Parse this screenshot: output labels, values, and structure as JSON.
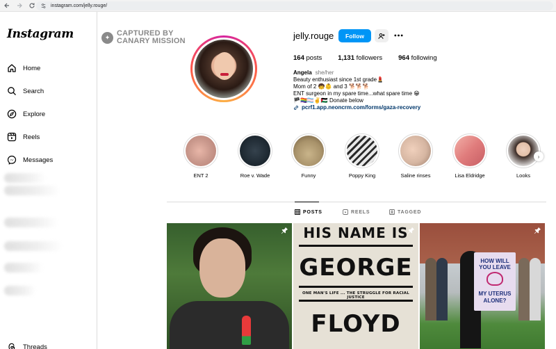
{
  "browser": {
    "url": "instagram.com/jelly.rouge/"
  },
  "sidebar": {
    "logo": "Instagram",
    "items": [
      {
        "label": "Home",
        "icon": "home-icon"
      },
      {
        "label": "Search",
        "icon": "search-icon"
      },
      {
        "label": "Explore",
        "icon": "compass-icon"
      },
      {
        "label": "Reels",
        "icon": "reels-icon"
      },
      {
        "label": "Messages",
        "icon": "messenger-icon"
      }
    ],
    "bottom_item": {
      "label": "Threads",
      "icon": "threads-icon"
    }
  },
  "watermark": {
    "line1": "CAPTURED BY",
    "line2": "CANARY MISSION"
  },
  "profile": {
    "username": "jelly.rouge",
    "follow_label": "Follow",
    "stats": {
      "posts_count": "164",
      "posts_label": "posts",
      "followers_count": "1,131",
      "followers_label": "followers",
      "following_count": "964",
      "following_label": "following"
    },
    "bio": {
      "name": "Angela",
      "pronouns": "she/her",
      "line1": "Beauty enthusiast since 1st grade💄",
      "line2": "Mom of 2 🧒👶 and 3 🐕🐕🐕",
      "line3": "ENT surgeon in my spare time...what spare time 😁",
      "line4": "🏴🏳️‍🌈🏳️‍⚧️✌️🇵🇸 Donate below",
      "link": "pcrf1.app.neoncrm.com/forms/gaza-recovery"
    }
  },
  "highlights": [
    {
      "label": "ENT 2",
      "color": "#c9988c"
    },
    {
      "label": "Roe v. Wade",
      "color": "#1f2a33"
    },
    {
      "label": "Funny",
      "color": "#a8926a"
    },
    {
      "label": "Poppy King",
      "color": "#9aa0a6"
    },
    {
      "label": "Saline rinses",
      "color": "#d6b6a2"
    },
    {
      "label": "Lisa Eldridge",
      "color": "#e07c7c"
    },
    {
      "label": "Looks",
      "color": "#3a2a24"
    }
  ],
  "tabs": [
    {
      "label": "POSTS",
      "icon": "grid-icon",
      "active": true
    },
    {
      "label": "REELS",
      "icon": "reels-icon",
      "active": false
    },
    {
      "label": "TAGGED",
      "icon": "tagged-icon",
      "active": false
    }
  ],
  "posts": {
    "post2": {
      "line1": "HIS NAME IS",
      "line2": "GEORGE",
      "line3": "ONE MAN'S LIFE ... THE STRUGGLE FOR RACIAL JUSTICE",
      "line4": "FLOYD"
    },
    "post3": {
      "sign1": "HOW WILL",
      "sign2": "YOU LEAVE",
      "sign3": "MY UTERUS",
      "sign4": "ALONE?"
    }
  }
}
